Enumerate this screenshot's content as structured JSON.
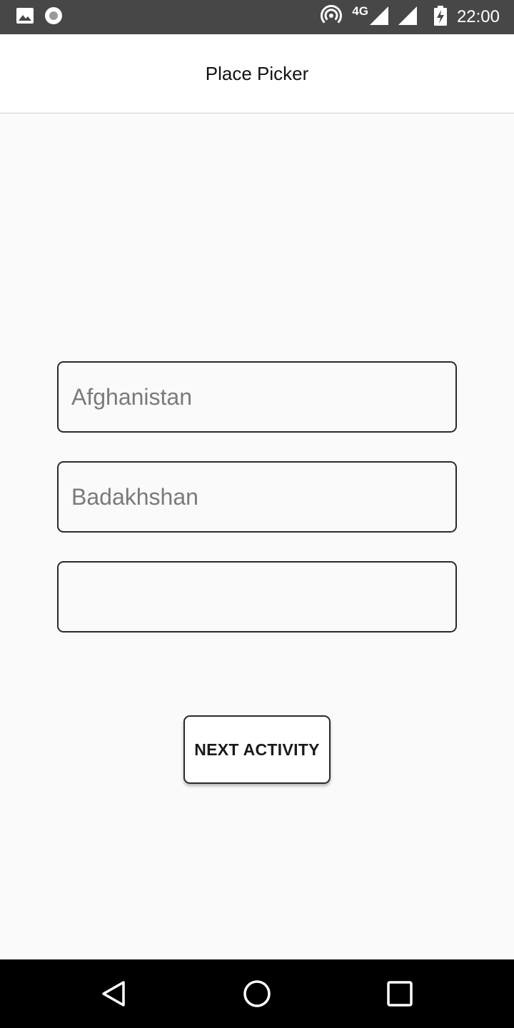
{
  "status_bar": {
    "left_icons": [
      "image-icon",
      "record-icon"
    ],
    "right_icons": [
      "hotspot-icon",
      "signal-icon",
      "signal-icon",
      "battery-charging-icon"
    ],
    "network": "4G",
    "time": "22:00"
  },
  "app_bar": {
    "title": "Place Picker"
  },
  "form": {
    "country_value": "Afghanistan",
    "state_value": "Badakhshan",
    "city_value": ""
  },
  "next_button": {
    "label": "NEXT ACTIVITY"
  },
  "nav_bar": {
    "icons": [
      "back-icon",
      "home-icon",
      "recents-icon"
    ]
  }
}
